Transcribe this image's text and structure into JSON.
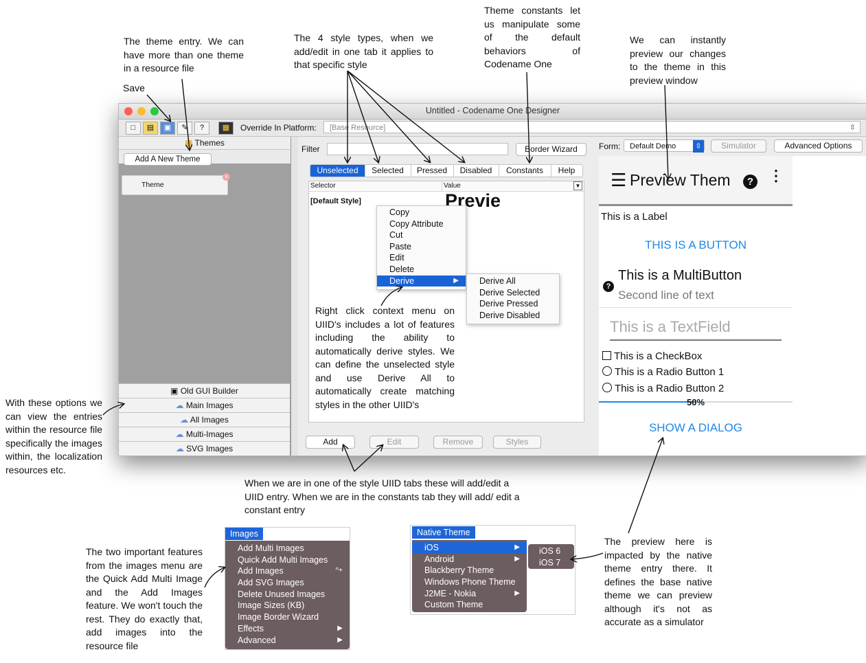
{
  "notes": {
    "theme_entry": "The theme entry. We can have more than one theme in a resource file",
    "save": "Save",
    "style_types": "The 4 style types, when we add/edit in one tab it applies to that specific style",
    "constants": "Theme constants let us manipulate some of the default behaviors of Codename One",
    "preview": "We can instantly preview our changes to the theme in this preview window",
    "options": "With these options we can view the entries within the resource file specifically the images within, the localization resources etc.",
    "context": "Right click context menu on UIID's includes a lot of features including the ability to automatically derive styles. We can define the unselected style and use Derive All to automatically create matching styles in the other UIID's",
    "add_edit": "When we are in one of the style UIID tabs these will add/edit a UIID entry. When we are in the constants tab they will add/ edit a constant entry",
    "images_menu": "The two important features from the images menu are the Quick Add Multi Image and the Add Images feature. We won't touch the rest. They do exactly that, add images into the resource file",
    "native_theme": "The preview here is impacted by the native theme entry there. It defines the base native theme we can preview although it's not as accurate as a simulator"
  },
  "window": {
    "title": "Untitled - Codename One Designer",
    "override_label": "Override In Platform:",
    "override_value": "[Base Resource]"
  },
  "sidebar": {
    "themes_header": "Themes",
    "add_theme_button": "Add A New Theme",
    "theme_item": "Theme",
    "buttons": [
      "Old GUI Builder",
      "Main Images",
      "All Images",
      "Multi-Images",
      "SVG Images"
    ]
  },
  "editor": {
    "filter_label": "Filter",
    "filter_value": "",
    "border_wizard": "Border Wizard",
    "tabs": [
      "Unselected",
      "Selected",
      "Pressed",
      "Disabled",
      "Constants",
      "Help"
    ],
    "col_selector": "Selector",
    "col_value": "Value",
    "row_selector": "[Default Style]",
    "row_value": "Previe",
    "bottom_buttons": [
      "Add",
      "Edit",
      "Remove",
      "Styles"
    ]
  },
  "context_menu": {
    "items": [
      "Copy",
      "Copy Attribute",
      "Cut",
      "Paste",
      "Edit",
      "Delete",
      "Derive"
    ],
    "submenu": [
      "Derive All",
      "Derive Selected",
      "Derive Pressed",
      "Derive Disabled"
    ]
  },
  "preview_panel": {
    "form_label": "Form:",
    "form_value": "Default Demo",
    "simulator": "Simulator",
    "advanced": "Advanced Options",
    "title": "Preview Them",
    "label": "This is a Label",
    "button": "THIS IS A BUTTON",
    "multibutton": "This is a MultiButton",
    "multibutton_line2": "Second line of text",
    "textfield": "This is a TextField",
    "checkbox": "This is a CheckBox",
    "radio1": "This is a Radio Button 1",
    "radio2": "This is a Radio Button 2",
    "progress_text": "50%",
    "progress": 0.5,
    "dialog_button": "SHOW A DIALOG"
  },
  "images_menu": {
    "title": "Images",
    "items": [
      "Add Multi Images",
      "Quick Add Multi Images",
      "Add Images",
      "Add SVG Images",
      "Delete Unused Images",
      "Image Sizes (KB)",
      "Image Border Wizard",
      "Effects",
      "Advanced"
    ],
    "shortcut": "^+"
  },
  "native_menu": {
    "title": "Native Theme",
    "items": [
      "iOS",
      "Android",
      "Blackberry Theme",
      "Windows Phone Theme",
      "J2ME - Nokia",
      "Custom Theme"
    ],
    "submenu": [
      "iOS 6",
      "iOS 7"
    ]
  },
  "colors": {
    "accent": "#1a63d6",
    "preview_link": "#1e88e5",
    "menu_dark": "#6c5d60"
  }
}
